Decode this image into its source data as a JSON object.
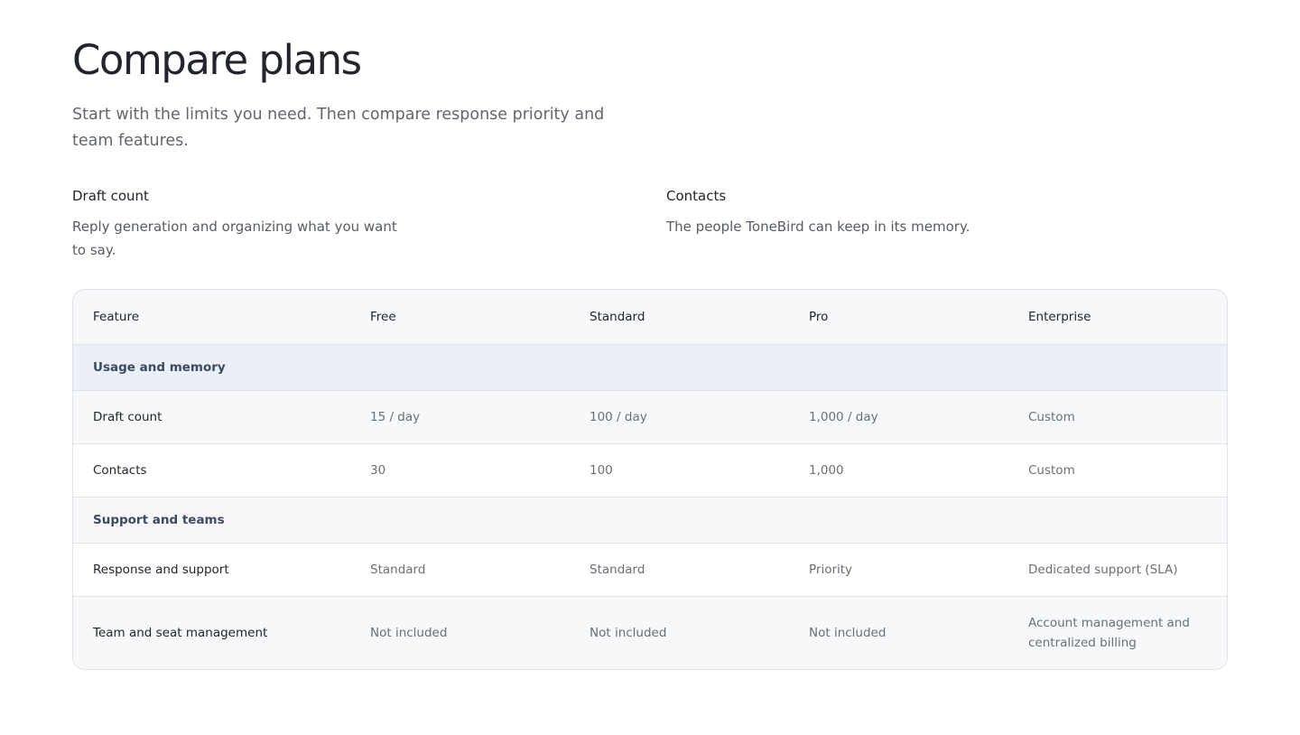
{
  "page": {
    "title": "Compare plans",
    "subtitle": "Start with the limits you need. Then compare response priority and team features."
  },
  "metrics": [
    {
      "name": "Draft count",
      "description": "Reply generation and organizing what you want to say."
    },
    {
      "name": "Contacts",
      "description": "The people ToneBird can keep in its memory."
    }
  ],
  "table": {
    "headers": [
      "Feature",
      "Free",
      "Standard",
      "Pro",
      "Enterprise"
    ],
    "sections": [
      {
        "label": "Usage and memory",
        "rows": [
          {
            "feature": "Draft count",
            "values": [
              "15 / day",
              "100 / day",
              "1,000 / day",
              "Custom"
            ]
          },
          {
            "feature": "Contacts",
            "values": [
              "30",
              "100",
              "1,000",
              "Custom"
            ]
          }
        ]
      },
      {
        "label": "Support and teams",
        "rows": [
          {
            "feature": "Response and support",
            "values": [
              "Standard",
              "Standard",
              "Priority",
              "Dedicated support (SLA)"
            ]
          },
          {
            "feature": "Team and seat management",
            "values": [
              "Not included",
              "Not included",
              "Not included",
              "Account management and centralized billing"
            ]
          }
        ]
      }
    ]
  }
}
